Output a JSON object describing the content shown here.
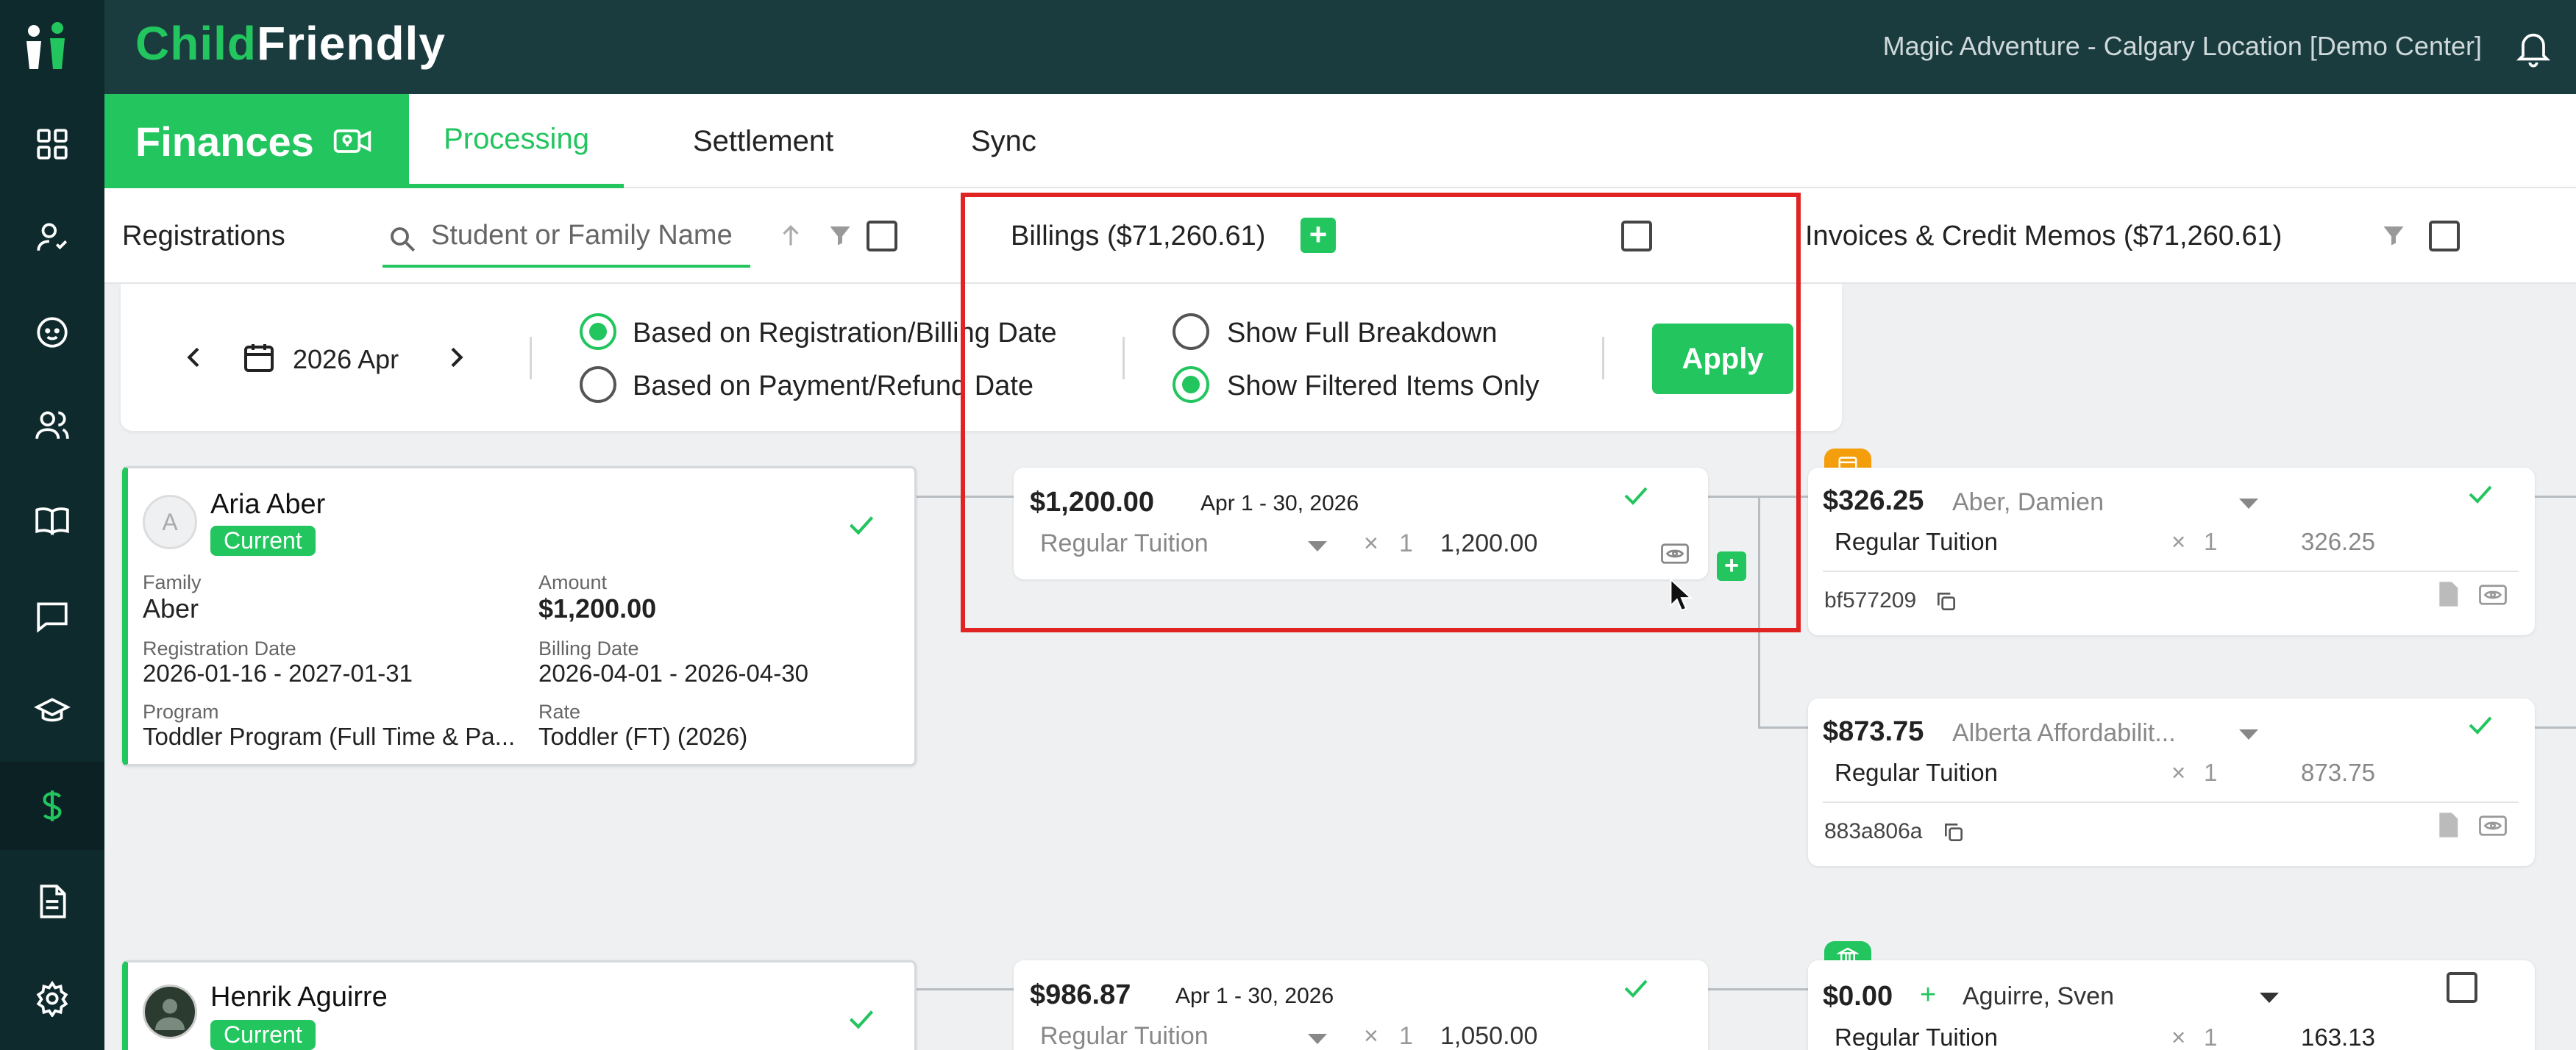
{
  "app": {
    "brand_prefix": "Child",
    "brand_suffix": "Friendly",
    "location": "Magic Adventure - Calgary Location [Demo Center]"
  },
  "sidebar": {
    "items": [
      {
        "name": "dashboard-icon"
      },
      {
        "name": "staff-icon"
      },
      {
        "name": "child-icon"
      },
      {
        "name": "families-icon"
      },
      {
        "name": "book-icon"
      },
      {
        "name": "messages-icon"
      },
      {
        "name": "education-icon"
      },
      {
        "name": "finances-icon",
        "active": true
      },
      {
        "name": "reports-icon"
      },
      {
        "name": "settings-icon"
      }
    ]
  },
  "section": {
    "title": "Finances",
    "tabs": [
      {
        "label": "Processing",
        "active": true
      },
      {
        "label": "Settlement"
      },
      {
        "label": "Sync"
      }
    ]
  },
  "columns": {
    "registrations": "Registrations",
    "search_placeholder": "Student or Family Name",
    "billings": "Billings ($71,260.61)",
    "invoices": "Invoices & Credit Memos ($71,260.61)"
  },
  "filters": {
    "period": "2026 Apr",
    "basis_options": [
      {
        "label": "Based on Registration/Billing Date",
        "selected": true
      },
      {
        "label": "Based on Payment/Refund Date",
        "selected": false
      }
    ],
    "view_options": [
      {
        "label": "Show Full Breakdown",
        "selected": false
      },
      {
        "label": "Show Filtered Items Only",
        "selected": true
      }
    ],
    "apply_label": "Apply"
  },
  "registrations": [
    {
      "initial": "A",
      "name": "Aria Aber",
      "status": "Current",
      "family_label": "Family",
      "family": "Aber",
      "amount_label": "Amount",
      "amount": "$1,200.00",
      "reg_date_label": "Registration Date",
      "reg_date": "2026-01-16 - 2027-01-31",
      "billing_date_label": "Billing Date",
      "billing_date": "2026-04-01 - 2026-04-30",
      "program_label": "Program",
      "program": "Toddler Program (Full Time & Pa...",
      "rate_label": "Rate",
      "rate": "Toddler (FT) (2026)"
    },
    {
      "name": "Henrik Aguirre",
      "status": "Current"
    }
  ],
  "billings": [
    {
      "amount": "$1,200.00",
      "period": "Apr 1 - 30, 2026",
      "item": "Regular Tuition",
      "qty_symbol": "×",
      "qty": "1",
      "line_total": "1,200.00"
    },
    {
      "amount": "$986.87",
      "period": "Apr 1 - 30, 2026",
      "item": "Regular Tuition",
      "qty_symbol": "×",
      "qty": "1",
      "line_total": "1,050.00"
    }
  ],
  "invoices": [
    {
      "amount": "$326.25",
      "payer": "Aber, Damien",
      "item": "Regular Tuition",
      "qty_symbol": "×",
      "qty": "1",
      "line_total": "326.25",
      "ref": "bf577209",
      "tag_color": "#f59e0b"
    },
    {
      "amount": "$873.75",
      "payer": "Alberta Affordabilit...",
      "item": "Regular Tuition",
      "qty_symbol": "×",
      "qty": "1",
      "line_total": "873.75",
      "ref": "883a806a"
    },
    {
      "amount": "$0.00",
      "plus": "+",
      "payer": "Aguirre, Sven",
      "item": "Regular Tuition",
      "qty_symbol": "×",
      "qty": "1",
      "line_total": "163.13",
      "tag_color": "#22c55e"
    }
  ],
  "colors": {
    "accent": "#22c55e",
    "sidebar": "#0f2a2d",
    "header": "#1a3c3f",
    "highlight": "#e02424"
  }
}
